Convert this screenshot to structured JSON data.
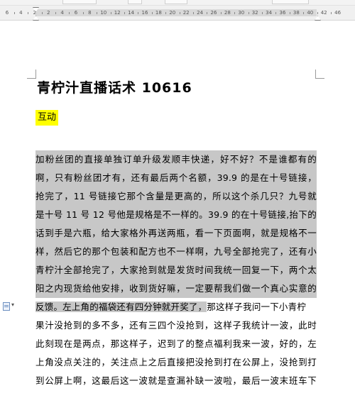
{
  "ruler": {
    "numbers": [
      "6",
      "4",
      "2",
      "2",
      "4",
      "6",
      "8",
      "10",
      "12",
      "14",
      "16",
      "18",
      "20",
      "22",
      "24",
      "26",
      "28",
      "30",
      "32",
      "34",
      "36",
      "38",
      "40",
      "42",
      "46"
    ]
  },
  "document": {
    "title": "青柠汁直播话术 10616",
    "heading": "互动",
    "lines": [
      "加粉丝团的直接单独订单升级发顺丰快递，好不好？不是谁都有的",
      "啊，只有粉丝团才有，还有最后两个名额，39.9 的是在十号链接，",
      "抢完了，11 号链接它那个含量是更高的，所以这个杀几只？九号就",
      "是十号 11 号 12 号他是规格是不一样的。39.9 的在十号链接,抬下的",
      "话到手是六瓶，给大家格外再送两瓶，看一下页面啊，就是规格不一",
      "样，然后它的那个包装和配方也不一样啊，九号全部抢完了，还有小",
      "青柠汁全部抢完了，大家抢到就是发货时间我统一回复一下，两个太",
      "阳之内现货给他安排，收到货好嘛，一定要帮我们做一个真心实意的",
      "反馈。左上角的福袋还有四分钟就开奖了，",
      "果汁没抢到的多不多，还有三四个没抢到，这样子我统计一波，此时",
      "此刻现在是两点，那这样子，迟到了的整点福利我来一波，好的，左",
      "上角没点关注的，关注点上之后直接把没抢到打在公屏上，没抢到打",
      "到公屏上啊，这最后这一波就是查漏补缺一波啦，最后一波末班车下"
    ],
    "line9_tail": "那这样子我问一下小青柠"
  }
}
